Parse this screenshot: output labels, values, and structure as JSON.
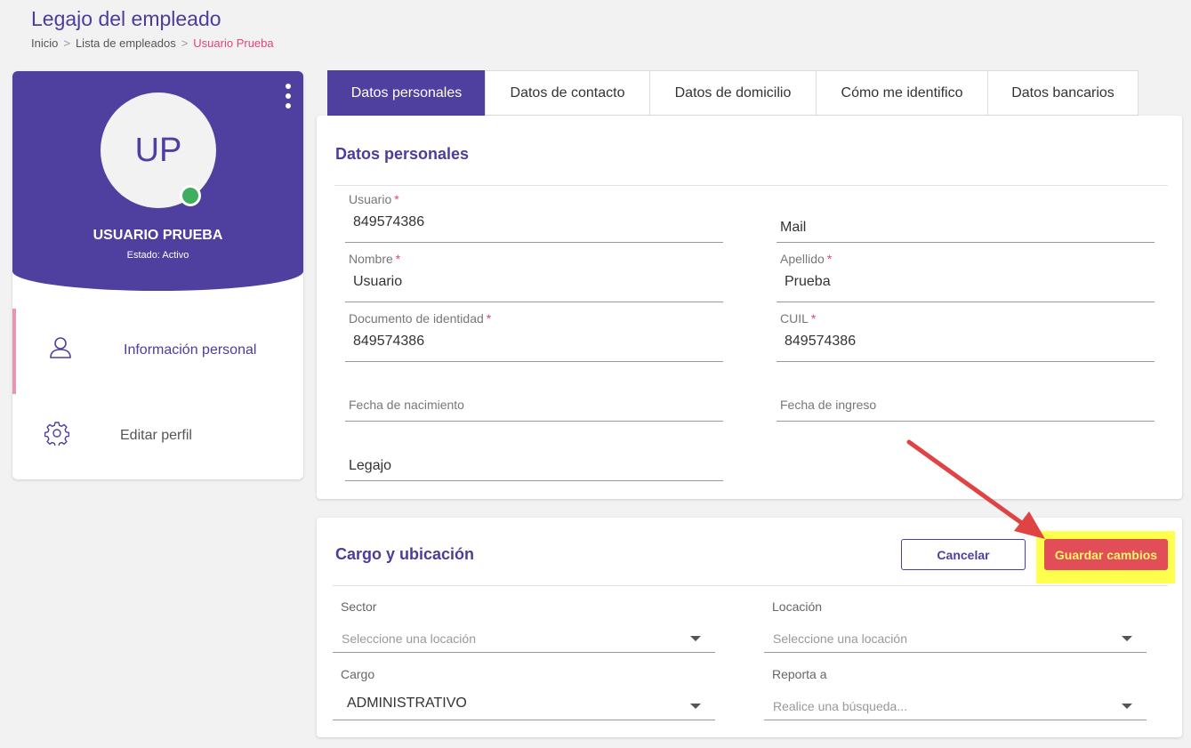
{
  "page": {
    "title": "Legajo del empleado",
    "breadcrumb": [
      "Inicio",
      "Lista de empleados",
      "Usuario Prueba"
    ],
    "breadcrumb_separator": ">"
  },
  "profile": {
    "initials": "UP",
    "name": "USUARIO PRUEBA",
    "status": "Estado: Activo",
    "status_color": "#3fae5e",
    "menu": [
      {
        "label": "Información personal",
        "icon": "user-icon",
        "active": true
      },
      {
        "label": "Editar perfil",
        "icon": "gear-icon",
        "active": false
      }
    ]
  },
  "tabs": [
    {
      "label": "Datos personales",
      "active": true
    },
    {
      "label": "Datos de contacto",
      "active": false
    },
    {
      "label": "Datos de domicilio",
      "active": false
    },
    {
      "label": "Cómo me identifico",
      "active": false
    },
    {
      "label": "Datos bancarios",
      "active": false
    }
  ],
  "personal": {
    "title": "Datos personales",
    "required_mark": "*",
    "fields": {
      "usuario": {
        "label": "Usuario",
        "value": "849574386"
      },
      "mail": {
        "label": "Mail"
      },
      "nombre": {
        "label": "Nombre",
        "value": "Usuario"
      },
      "apellido": {
        "label": "Apellido",
        "value": "Prueba"
      },
      "documento": {
        "label": "Documento de identidad",
        "value": "849574386"
      },
      "cuil": {
        "label": "CUIL",
        "value": "849574386"
      },
      "fecha_nacimiento": {
        "label": "Fecha de nacimiento"
      },
      "fecha_ingreso": {
        "label": "Fecha de ingreso"
      },
      "legajo": {
        "label": "Legajo"
      }
    }
  },
  "cargo": {
    "title": "Cargo y ubicación",
    "cancel_label": "Cancelar",
    "save_label": "Guardar cambios",
    "selects": {
      "sector": {
        "label": "Sector",
        "placeholder": "Seleccione una locación"
      },
      "locacion": {
        "label": "Locación",
        "placeholder": "Seleccione una locación"
      },
      "cargo": {
        "label": "Cargo",
        "value": "ADMINISTRATIVO"
      },
      "reporta": {
        "label": "Reporta a",
        "placeholder": "Realice una búsqueda..."
      }
    }
  },
  "colors": {
    "brand": "#4f3f9f",
    "accent_pink": "#e0457b",
    "save_button": "#e24e57",
    "highlight": "#ffff4d",
    "annotation_arrow": "#e04343"
  }
}
